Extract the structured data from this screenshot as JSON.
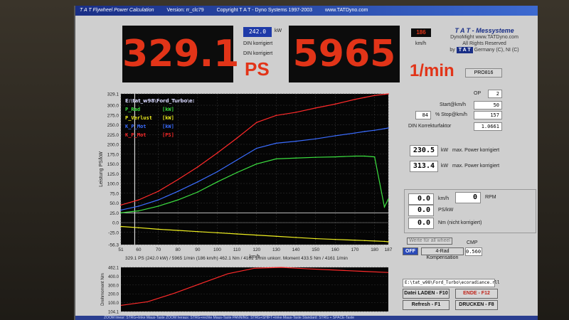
{
  "titlebar": {
    "app_name": "T A T Flywheel Power Calculation",
    "version": "Version: rr_clc79",
    "copyright": "Copyright  T A T - Dyno Systems  1997-2003",
    "url": "www.TATDyno.com"
  },
  "readouts": {
    "power_ps": "329.1",
    "power_kw": "242.0",
    "kw_unit": "kW",
    "din_label_1": "DIN korrigiert",
    "din_label_2": "DIN korrigiert",
    "ps_unit": "PS",
    "rpm": "5965",
    "rpm_unit": "1/min",
    "speed": "186",
    "speed_unit": "km/h"
  },
  "brand": {
    "title": "T A T - Messysteme",
    "product": "DynoMight  www.TATDyno.com",
    "rights": "All Rights Reserved",
    "by": "by",
    "tat": "T A T",
    "country": "Germany (C), NI (C)",
    "pro_button": "PRO816"
  },
  "legend": {
    "file": "E:\\tat_w98\\Ford_Turbo\\e:",
    "items": [
      {
        "name": "P_Rad",
        "unit": "[kW]",
        "color": "#3ce040"
      },
      {
        "name": "P_Verlust",
        "unit": "[kW]",
        "color": "#f0f020"
      },
      {
        "name": "K_P_Mot",
        "unit": "[kW]",
        "color": "#3a6cff"
      },
      {
        "name": "K_P_Mot",
        "unit": "[PS]",
        "color": "#ff2a2a"
      }
    ]
  },
  "chart_data": {
    "type": "line",
    "xlabel": "km/h",
    "ylabel": "Leistung PS/kW",
    "xlim": [
      51,
      187
    ],
    "ylim": [
      -56.3,
      329.1
    ],
    "x_ticks": [
      "51",
      "60",
      "70",
      "80",
      "90",
      "100",
      "110",
      "120",
      "130",
      "140",
      "150",
      "160",
      "170",
      "180",
      "187"
    ],
    "y_ticks": [
      "329.1",
      "300.0",
      "275.0",
      "250.0",
      "225.0",
      "200.0",
      "175.0",
      "150.0",
      "125.0",
      "100.0",
      "75.0",
      "50.0",
      "25.0",
      "0.0",
      "-25.0",
      "-56.3"
    ],
    "x": [
      51,
      60,
      70,
      80,
      90,
      100,
      110,
      120,
      130,
      140,
      150,
      160,
      170,
      175,
      180,
      185,
      187
    ],
    "series": [
      {
        "name": "P_Rad",
        "values": [
          25,
          30,
          42,
          58,
          78,
          104,
          128,
          150,
          163,
          165,
          167,
          168,
          170,
          170,
          168,
          40,
          60
        ]
      },
      {
        "name": "P_Verlust",
        "values": [
          -10,
          -13,
          -17,
          -20,
          -23,
          -26,
          -29,
          -32,
          -35,
          -38,
          -41,
          -43,
          -45,
          -46,
          -47,
          -48,
          -49
        ]
      },
      {
        "name": "K_P_Mot kW",
        "values": [
          32,
          42,
          58,
          80,
          104,
          130,
          160,
          190,
          203,
          208,
          214,
          222,
          229,
          233,
          236,
          240,
          242
        ]
      },
      {
        "name": "K_P_Mot PS",
        "values": [
          45,
          58,
          80,
          110,
          142,
          178,
          216,
          256,
          274,
          282,
          293,
          303,
          315,
          320,
          325,
          328,
          329.1
        ]
      }
    ],
    "marker_x": 58,
    "grid": true
  },
  "info_line": "329.1 PS  (242.0 kW)  / 5965 1/min (186 km/h)    462.1 Nm / 4161 1/min    unkorr. Moment  433.5 Nm / 4161 1/min",
  "right_panel": {
    "op_label": "OP",
    "op_value": "2",
    "start_label": "Start@km/h",
    "start_value": "50",
    "stop_label": "% Stop@km/h",
    "stop_pct": "84",
    "stop_value": "157",
    "din_factor_label": "DIN Korrekturfaktor",
    "din_factor": "1.0661",
    "max_power_kw": "230.5",
    "max_power_kw_unit": "kW",
    "max_power_kw_label": "max. Power korrigiert",
    "max_power_ps": "313.4",
    "max_power_ps_unit": "kW",
    "max_power_ps_label": "max. Power korrigiert",
    "speed_now": "0.0",
    "speed_unit": "km/h",
    "rpm_now": "0",
    "rpm_unit": "RPM",
    "ps_now": "0.0",
    "ps_unit": "PS/kW",
    "nm_now": "0.0",
    "nm_unit": "Nm (nicht korrigiert)",
    "all_values_button": "Werte für all wheel",
    "off_button": "OFF",
    "rad_komp": "4-Rad Kompensation",
    "cmp_label": "CMP",
    "cmp_value": "0.560",
    "file_path": "E:\\tat_w98\\Ford_Turbo\\ecoradiance.rll",
    "load_button": "Datei LADEN - F10",
    "end_button": "ENDE - F12",
    "refresh_button": "Refresh - F1",
    "print_button": "DRUCKEN - F8"
  },
  "mini_chart": {
    "ylabel": "Drehmoment Nm",
    "y_ticks": [
      "462.1",
      "400.0",
      "300.0",
      "200.0",
      "100.0",
      "104.1"
    ],
    "x": [
      0,
      10,
      20,
      30,
      40,
      50,
      60,
      70,
      80,
      90,
      100
    ],
    "values": [
      150,
      180,
      250,
      330,
      410,
      455,
      462,
      450,
      440,
      430,
      420
    ]
  },
  "status_bar": "ZOOM linear: STRG+linke Maus-Taste     ZOOM heraus: STRG+rechte Maus-Taste     PANNING: STRG+SHIFT+linke Maus-Taste     Standard: STRG + SPACE-Taste"
}
